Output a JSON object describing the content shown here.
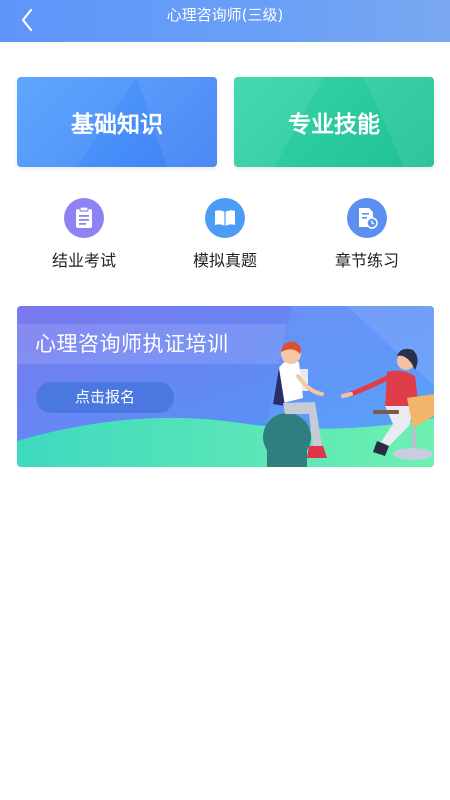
{
  "header": {
    "title": "心理咨询师(三级)",
    "back_icon": "chevron-left-icon",
    "color": "#6a9ff7"
  },
  "cards": [
    {
      "label": "基础知识",
      "color": "#4b8cf8"
    },
    {
      "label": "专业技能",
      "color": "#2bc99f"
    }
  ],
  "entries": [
    {
      "label": "结业考试",
      "icon": "clipboard-icon",
      "color": "#8a7bf0"
    },
    {
      "label": "模拟真题",
      "icon": "book-icon",
      "color": "#4a9af5"
    },
    {
      "label": "章节练习",
      "icon": "document-clock-icon",
      "color": "#5a8ef0"
    }
  ],
  "banner": {
    "title": "心理咨询师执证培训",
    "button_label": "点击报名"
  }
}
